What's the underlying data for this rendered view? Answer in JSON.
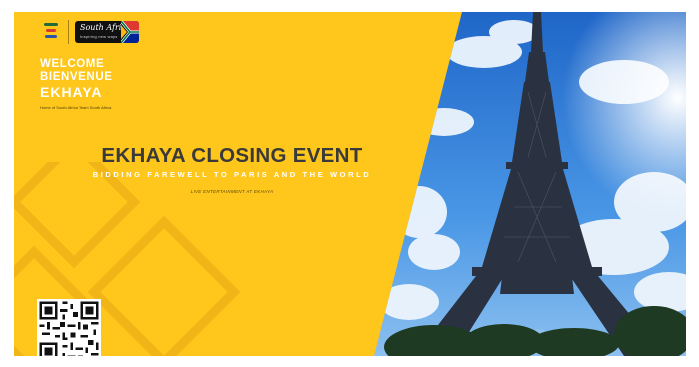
{
  "header": {
    "sa_logo_text": "South Africa",
    "sa_logo_tagline": "Inspiring new ways",
    "welcome_lines": [
      "WELCOME",
      "BIENVENUE",
      "EKHAYA"
    ],
    "welcome_subtext": "Home of South Africa Team South Africa"
  },
  "event": {
    "title": "EKHAYA CLOSING EVENT",
    "subtitle": "BIDDING FAREWELL TO PARIS AND THE WORLD",
    "small_line": "LIVE ENTERTAINMENT AT EKHAYA"
  },
  "colors": {
    "background_yellow": "#FFC61B",
    "title_gray": "#3a3a3a",
    "sky_blue": "#2f7fd8",
    "tower_dark": "#2a3140"
  },
  "icons": [
    "team-south-africa-emblem-icon",
    "south-africa-flag-icon",
    "qr-code-icon",
    "eiffel-tower-image"
  ]
}
